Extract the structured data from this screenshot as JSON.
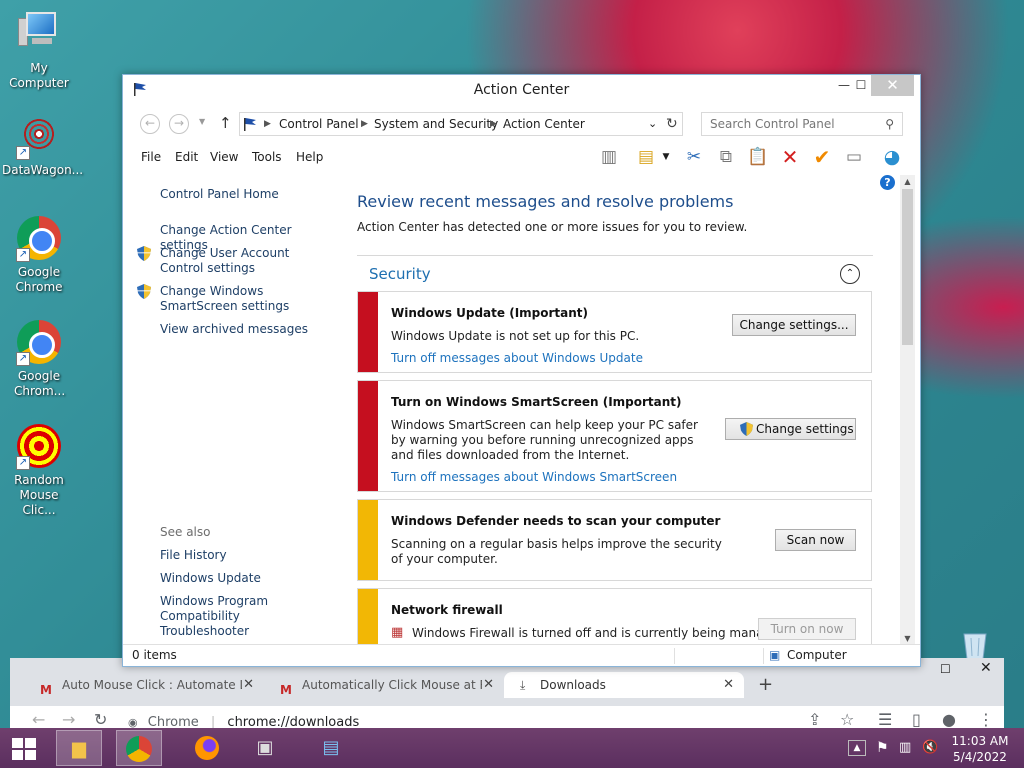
{
  "desktop": {
    "icons": [
      {
        "label": "My Computer"
      },
      {
        "label": "DataWagon..."
      },
      {
        "label": "Google Chrome"
      },
      {
        "label": "Google Chrom..."
      },
      {
        "label": "Random Mouse Clic..."
      }
    ]
  },
  "window": {
    "title": "Action Center",
    "buttons": {
      "minimize": "—",
      "maximize": "☐",
      "close": "✕"
    },
    "breadcrumb": [
      "Control Panel",
      "System and Security",
      "Action Center"
    ],
    "search_placeholder": "Search Control Panel",
    "menu": [
      "File",
      "Edit",
      "View",
      "Tools",
      "Help"
    ]
  },
  "sidebar": {
    "home": "Control Panel Home",
    "links": [
      "Change Action Center settings",
      "Change User Account Control settings",
      "Change Windows SmartScreen settings",
      "View archived messages"
    ],
    "see_also_title": "See also",
    "see_also": [
      "File History",
      "Windows Update",
      "Windows Program Compatibility Troubleshooter"
    ]
  },
  "main": {
    "heading": "Review recent messages and resolve problems",
    "subheading": "Action Center has detected one or more issues for you to review.",
    "section": "Security",
    "cards": [
      {
        "title": "Windows Update  (Important)",
        "desc": "Windows Update is not set up for this PC.",
        "link": "Turn off messages about Windows Update",
        "button": "Change settings...",
        "severity_color": "#c50f1f"
      },
      {
        "title": "Turn on Windows SmartScreen  (Important)",
        "desc": "Windows SmartScreen can help keep your PC safer by warning you before running unrecognized apps and files downloaded from the Internet.",
        "link": "Turn off messages about Windows SmartScreen",
        "button": "Change settings",
        "severity_color": "#c50f1f"
      },
      {
        "title": "Windows Defender needs to scan your computer",
        "desc": "Scanning on a regular basis helps improve the security of your computer.",
        "button": "Scan now",
        "severity_color": "#f2b705"
      },
      {
        "title": "Network firewall",
        "desc": "Windows Firewall is turned off and is currently being managed",
        "button": "Turn on now",
        "severity_color": "#f2b705"
      }
    ]
  },
  "status": {
    "items": "0 items",
    "location": "Computer"
  },
  "chrome": {
    "tabs": [
      {
        "title": "Auto Mouse Click : Automate Lef"
      },
      {
        "title": "Automatically Click Mouse at Ran"
      },
      {
        "title": "Downloads"
      }
    ],
    "omnibox_site": "Chrome",
    "omnibox_url": "chrome://downloads"
  },
  "taskbar": {
    "time": "11:03 AM",
    "date": "5/4/2022"
  }
}
